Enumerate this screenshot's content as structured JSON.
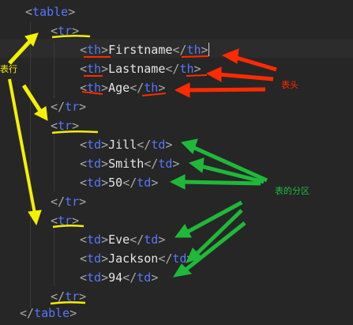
{
  "code": {
    "lines": [
      {
        "open": "<",
        "tag": "table",
        "close": ">"
      },
      {
        "open": "<",
        "tag": "tr",
        "close": ">"
      },
      {
        "open": "<",
        "tag": "th",
        "close": ">",
        "text": "Firstname",
        "end_open": "</",
        "end_tag": "th",
        "end_close": ">"
      },
      {
        "open": "<",
        "tag": "th",
        "close": ">",
        "text": "Lastname",
        "end_open": "</",
        "end_tag": "th",
        "end_close": ">"
      },
      {
        "open": "<",
        "tag": "th",
        "close": ">",
        "text": "Age",
        "end_open": "</",
        "end_tag": "th",
        "end_close": ">"
      },
      {
        "open": "</",
        "tag": "tr",
        "close": ">"
      },
      {
        "open": "<",
        "tag": "tr",
        "close": ">"
      },
      {
        "open": "<",
        "tag": "td",
        "close": ">",
        "text": "Jill",
        "end_open": "</",
        "end_tag": "td",
        "end_close": ">"
      },
      {
        "open": "<",
        "tag": "td",
        "close": ">",
        "text": "Smith",
        "end_open": "</",
        "end_tag": "td",
        "end_close": ">"
      },
      {
        "open": "<",
        "tag": "td",
        "close": ">",
        "text": "50",
        "end_open": "</",
        "end_tag": "td",
        "end_close": ">"
      },
      {
        "open": "</",
        "tag": "tr",
        "close": ">"
      },
      {
        "open": "<",
        "tag": "tr",
        "close": ">"
      },
      {
        "open": "<",
        "tag": "td",
        "close": ">",
        "text": "Eve",
        "end_open": "</",
        "end_tag": "td",
        "end_close": ">"
      },
      {
        "open": "<",
        "tag": "td",
        "close": ">",
        "text": "Jackson",
        "end_open": "</",
        "end_tag": "td",
        "end_close": ">"
      },
      {
        "open": "<",
        "tag": "td",
        "close": ">",
        "text": "94",
        "end_open": "</",
        "end_tag": "td",
        "end_close": ">"
      },
      {
        "open": "</",
        "tag": "tr",
        "close": ">"
      },
      {
        "open": "</",
        "tag": "table",
        "close": ">"
      }
    ]
  },
  "annotations": {
    "row_label": "表行",
    "header_label": "表头",
    "data_label": "表的分区",
    "colors": {
      "yellow": "#f5f000",
      "red": "#ff2a00",
      "green": "#1fb83a"
    }
  }
}
